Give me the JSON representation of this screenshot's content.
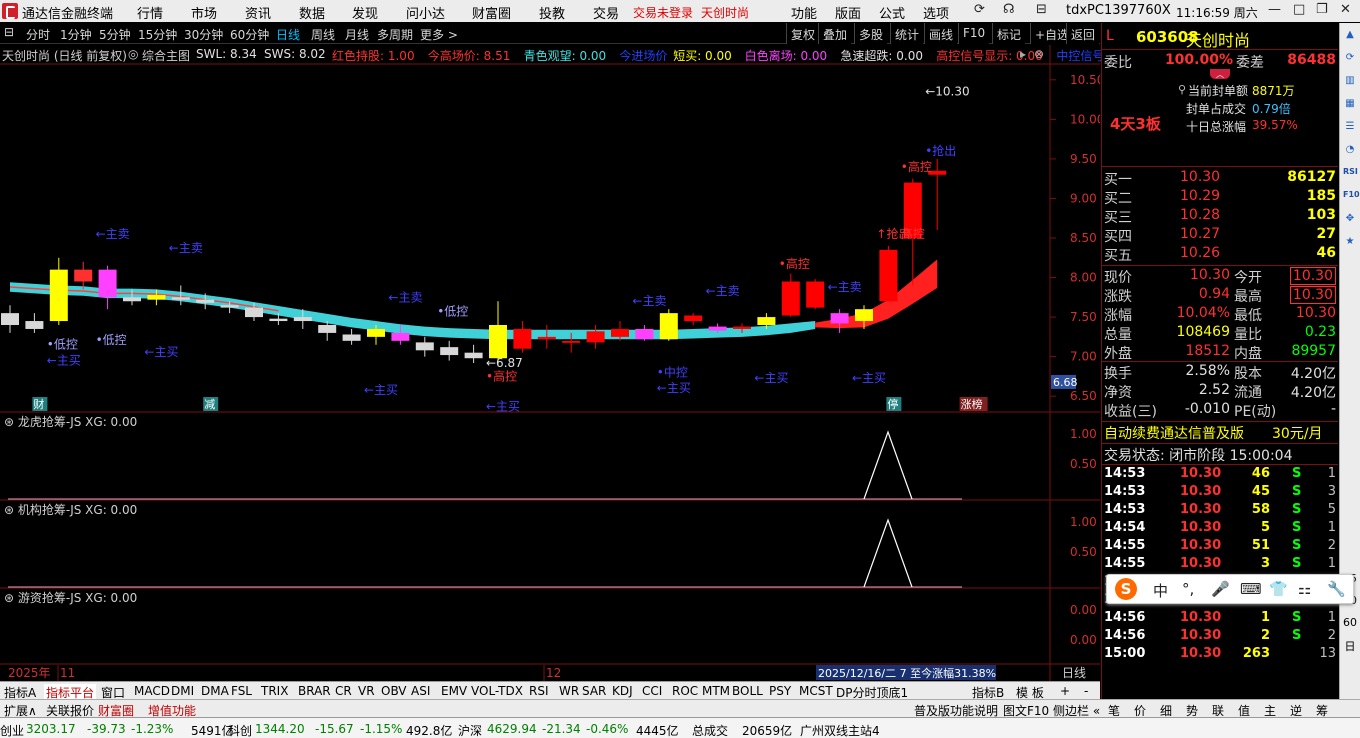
{
  "window": {
    "title": "通达信金融终端",
    "tdx": "tdxPC1397760X",
    "time": "11:16:59 周六"
  },
  "menu": [
    "行情",
    "市场",
    "资讯",
    "数据",
    "发现",
    "问小达",
    "财富圈",
    "投教",
    "交易"
  ],
  "menu_red": [
    "交易未登录",
    "天创时尚"
  ],
  "menu_right": [
    "功能",
    "版面",
    "公式",
    "选项"
  ],
  "toolbar": [
    "分时",
    "1分钟",
    "5分钟",
    "15分钟",
    "30分钟",
    "60分钟",
    "日线",
    "周线",
    "月线",
    "多周期",
    "更多 >"
  ],
  "toolbar_selected": "日线",
  "toolbar_right": [
    "复权",
    "叠加",
    "多股",
    "统计",
    "画线",
    "F10",
    "标记",
    "+自选",
    "返回"
  ],
  "indicator": {
    "name": "天创时尚 (日线 前复权)",
    "formula": "综合主图",
    "items": [
      {
        "t": "SWL: 8.34",
        "c": "#e0e0e0"
      },
      {
        "t": "SWS: 8.02",
        "c": "#e0e0e0"
      },
      {
        "t": "红色持股: 1.00",
        "c": "#ff3030"
      },
      {
        "t": "今高场价: 8.51",
        "c": "#ff3030"
      },
      {
        "t": "青色观望: 0.00",
        "c": "#40e0e0"
      },
      {
        "t": "今进场价",
        "c": "#2040ff"
      },
      {
        "t": "短买: 0.00",
        "c": "#ffff00"
      },
      {
        "t": "白色离场: 0.00",
        "c": "#ff40ff"
      },
      {
        "t": "急速超跌: 0.00",
        "c": "#e0e0e0"
      },
      {
        "t": "高控信号显示: 0.00",
        "c": "#ff3030"
      },
      {
        "t": "中控信号",
        "c": "#2040ff"
      }
    ]
  },
  "chart_data": {
    "type": "candlestick",
    "y_ticks": [
      "10.50",
      "10.00",
      "9.50",
      "9.00",
      "8.50",
      "8.00",
      "7.50",
      "7.00",
      "6.50"
    ],
    "ylim": [
      6.3,
      10.7
    ],
    "current_price_tag": "6.68",
    "x_labels": [
      "2025年",
      "11",
      "12"
    ],
    "candles": [
      {
        "o": 7.55,
        "c": 7.4,
        "h": 7.65,
        "l": 7.3,
        "col": "#d8d8d8"
      },
      {
        "o": 7.45,
        "c": 7.35,
        "h": 7.55,
        "l": 7.3,
        "col": "#d8d8d8"
      },
      {
        "o": 7.45,
        "c": 8.1,
        "h": 8.25,
        "l": 7.4,
        "col": "#ffff00"
      },
      {
        "o": 7.95,
        "c": 8.1,
        "h": 8.2,
        "l": 7.85,
        "col": "#ff3030"
      },
      {
        "o": 8.1,
        "c": 7.75,
        "h": 8.15,
        "l": 7.6,
        "col": "#ff40ff"
      },
      {
        "o": 7.75,
        "c": 7.7,
        "h": 7.85,
        "l": 7.65,
        "col": "#d8d8d8"
      },
      {
        "o": 7.72,
        "c": 7.78,
        "h": 7.85,
        "l": 7.65,
        "col": "#ffff00"
      },
      {
        "o": 7.75,
        "c": 7.72,
        "h": 7.9,
        "l": 7.65,
        "col": "#d8d8d8"
      },
      {
        "o": 7.72,
        "c": 7.68,
        "h": 7.8,
        "l": 7.6,
        "col": "#d8d8d8"
      },
      {
        "o": 7.65,
        "c": 7.62,
        "h": 7.7,
        "l": 7.55,
        "col": "#d8d8d8"
      },
      {
        "o": 7.62,
        "c": 7.5,
        "h": 7.68,
        "l": 7.45,
        "col": "#d8d8d8"
      },
      {
        "o": 7.48,
        "c": 7.45,
        "h": 7.55,
        "l": 7.4,
        "col": "#d8d8d8"
      },
      {
        "o": 7.45,
        "c": 7.5,
        "h": 7.6,
        "l": 7.35,
        "col": "#d8d8d8"
      },
      {
        "o": 7.4,
        "c": 7.3,
        "h": 7.45,
        "l": 7.2,
        "col": "#d8d8d8"
      },
      {
        "o": 7.28,
        "c": 7.2,
        "h": 7.35,
        "l": 7.15,
        "col": "#d8d8d8"
      },
      {
        "o": 7.25,
        "c": 7.35,
        "h": 7.4,
        "l": 7.15,
        "col": "#ffff00"
      },
      {
        "o": 7.3,
        "c": 7.2,
        "h": 7.4,
        "l": 7.15,
        "col": "#ff40ff"
      },
      {
        "o": 7.18,
        "c": 7.08,
        "h": 7.25,
        "l": 7.0,
        "col": "#d8d8d8"
      },
      {
        "o": 7.12,
        "c": 7.02,
        "h": 7.2,
        "l": 6.95,
        "col": "#d8d8d8"
      },
      {
        "o": 7.05,
        "c": 6.98,
        "h": 7.15,
        "l": 6.92,
        "col": "#d8d8d8"
      },
      {
        "o": 6.98,
        "c": 7.4,
        "h": 7.7,
        "l": 6.88,
        "col": "#ffff00"
      },
      {
        "o": 7.1,
        "c": 7.35,
        "h": 7.45,
        "l": 7.05,
        "col": "#ff0000"
      },
      {
        "o": 7.22,
        "c": 7.25,
        "h": 7.4,
        "l": 7.1,
        "col": "#ff0000"
      },
      {
        "o": 7.2,
        "c": 7.18,
        "h": 7.3,
        "l": 7.05,
        "col": "#ff0000"
      },
      {
        "o": 7.18,
        "c": 7.32,
        "h": 7.4,
        "l": 7.1,
        "col": "#ff0000"
      },
      {
        "o": 7.25,
        "c": 7.35,
        "h": 7.45,
        "l": 7.2,
        "col": "#ff0000"
      },
      {
        "o": 7.35,
        "c": 7.22,
        "h": 7.4,
        "l": 7.2,
        "col": "#ff40ff"
      },
      {
        "o": 7.22,
        "c": 7.55,
        "h": 7.6,
        "l": 7.2,
        "col": "#ffff00"
      },
      {
        "o": 7.45,
        "c": 7.52,
        "h": 7.55,
        "l": 7.4,
        "col": "#ff0000"
      },
      {
        "o": 7.38,
        "c": 7.33,
        "h": 7.42,
        "l": 7.3,
        "col": "#ff40ff"
      },
      {
        "o": 7.35,
        "c": 7.38,
        "h": 7.42,
        "l": 7.3,
        "col": "#ff0000"
      },
      {
        "o": 7.4,
        "c": 7.5,
        "h": 7.55,
        "l": 7.35,
        "col": "#ffff00"
      },
      {
        "o": 7.52,
        "c": 7.95,
        "h": 8.05,
        "l": 7.5,
        "col": "#ff0000"
      },
      {
        "o": 7.62,
        "c": 7.95,
        "h": 7.98,
        "l": 7.6,
        "col": "#ff0000"
      },
      {
        "o": 7.55,
        "c": 7.42,
        "h": 7.6,
        "l": 7.3,
        "col": "#ff40ff"
      },
      {
        "o": 7.45,
        "c": 7.6,
        "h": 7.65,
        "l": 7.35,
        "col": "#ffff00"
      },
      {
        "o": 7.7,
        "c": 8.35,
        "h": 8.4,
        "l": 7.7,
        "col": "#ff0000"
      },
      {
        "o": 8.5,
        "c": 9.2,
        "h": 9.25,
        "l": 7.9,
        "col": "#ff0000"
      },
      {
        "o": 9.3,
        "c": 9.35,
        "h": 9.5,
        "l": 8.6,
        "col": "#ff0000"
      }
    ],
    "annotations": [
      {
        "t": "←主卖",
        "i": 4,
        "v": 8.5,
        "c": "#4040ff"
      },
      {
        "t": "←主卖",
        "i": 7,
        "v": 8.32,
        "c": "#4040ff"
      },
      {
        "t": "←主卖",
        "i": 16,
        "v": 7.7,
        "c": "#4040ff"
      },
      {
        "t": "←主卖",
        "i": 26,
        "v": 7.65,
        "c": "#4040ff"
      },
      {
        "t": "←主卖",
        "i": 29,
        "v": 7.78,
        "c": "#4040ff"
      },
      {
        "t": "←主卖",
        "i": 34,
        "v": 7.83,
        "c": "#4040ff"
      },
      {
        "t": "•低控",
        "i": 2,
        "v": 7.1,
        "c": "#a0a0ff"
      },
      {
        "t": "•低控",
        "i": 4,
        "v": 7.16,
        "c": "#a0a0ff"
      },
      {
        "t": "•低控",
        "i": 18,
        "v": 7.52,
        "c": "#a0a0ff"
      },
      {
        "t": "←主买",
        "i": 2,
        "v": 6.9,
        "c": "#4040ff"
      },
      {
        "t": "←主买",
        "i": 6,
        "v": 7.01,
        "c": "#4040ff"
      },
      {
        "t": "←主买",
        "i": 15,
        "v": 6.53,
        "c": "#4040ff"
      },
      {
        "t": "←主买",
        "i": 20,
        "v": 6.32,
        "c": "#4040ff"
      },
      {
        "t": "←主买",
        "i": 27,
        "v": 6.55,
        "c": "#4040ff"
      },
      {
        "t": "←主买",
        "i": 31,
        "v": 6.68,
        "c": "#4040ff"
      },
      {
        "t": "←主买",
        "i": 35,
        "v": 6.68,
        "c": "#4040ff"
      },
      {
        "t": "•中控",
        "i": 27,
        "v": 6.75,
        "c": "#4040ff"
      },
      {
        "t": "←6.87",
        "i": 20,
        "v": 6.87,
        "c": "#e0e0e0"
      },
      {
        "t": "•高控",
        "i": 20,
        "v": 6.7,
        "c": "#ff3030"
      },
      {
        "t": "•高控",
        "i": 32,
        "v": 8.12,
        "c": "#ff3030"
      },
      {
        "t": "↑抢出",
        "i": 36,
        "v": 8.5,
        "c": "#ff3030"
      },
      {
        "t": "高控",
        "i": 37,
        "v": 8.5,
        "c": "#ff3030"
      },
      {
        "t": "•高控",
        "i": 37,
        "v": 9.35,
        "c": "#ff3030"
      },
      {
        "t": "•抢出",
        "i": 38,
        "v": 9.55,
        "c": "#4040ff"
      },
      {
        "t": "←10.30",
        "i": 38,
        "v": 10.3,
        "c": "#e0e0e0"
      }
    ],
    "bottom_marks": [
      {
        "t": "财",
        "i": 1,
        "bg": "#208080"
      },
      {
        "t": "减",
        "i": 8,
        "bg": "#208080"
      },
      {
        "t": "停",
        "i": 36,
        "bg": "#208080"
      },
      {
        "t": "涨榜",
        "i": 39,
        "bg": "#802020"
      }
    ],
    "sub_panes": [
      {
        "title": "龙虎抢筹-JS XG: 0.00",
        "ticks": [
          "1.00",
          "0.50"
        ],
        "spike": true
      },
      {
        "title": "机构抢筹-JS XG: 0.00",
        "ticks": [
          "1.00",
          "0.50"
        ],
        "spike": true
      },
      {
        "title": "游资抢筹-JS XG: 0.00",
        "ticks": [
          "0.00",
          "0.00"
        ],
        "spike": false
      }
    ],
    "date_tip": "2025/12/16/二 7 至今涨幅31.38%",
    "period_label": "日线"
  },
  "quote": {
    "flag": "L",
    "code": "603608",
    "name": "天创时尚",
    "weibi_label": "委比",
    "weibi": "100.00%",
    "weicha_label": "委差",
    "weicha": "86488",
    "board": "4天3板",
    "seal_amount_label": "当前封单额",
    "seal_amount": "8871万",
    "seal_ratio_label": "封单占成交",
    "seal_ratio": "0.79倍",
    "ten_day_label": "十日总涨幅",
    "ten_day": "39.57%",
    "bids": [
      {
        "l": "买一",
        "p": "10.30",
        "v": "86127"
      },
      {
        "l": "买二",
        "p": "10.29",
        "v": "185"
      },
      {
        "l": "买三",
        "p": "10.28",
        "v": "103"
      },
      {
        "l": "买四",
        "p": "10.27",
        "v": "27"
      },
      {
        "l": "买五",
        "p": "10.26",
        "v": "46"
      }
    ],
    "stats": [
      {
        "l1": "现价",
        "v1": "10.30",
        "l2": "今开",
        "v2": "10.30",
        "box": true
      },
      {
        "l1": "涨跌",
        "v1": "0.94",
        "l2": "最高",
        "v2": "10.30",
        "box": true
      },
      {
        "l1": "涨幅",
        "v1": "10.04%",
        "l2": "最低",
        "v2": "10.30"
      },
      {
        "l1": "总量",
        "v1": "108469",
        "l2": "量比",
        "v2": "0.23",
        "v1c": "#ffff00",
        "v2c": "#00ff00"
      },
      {
        "l1": "外盘",
        "v1": "18512",
        "l2": "内盘",
        "v2": "89957",
        "v1c": "#ff3030",
        "v2c": "#00ff00"
      }
    ],
    "stats2": [
      {
        "l1": "换手",
        "v1": "2.58%",
        "l2": "股本",
        "v2": "4.20亿"
      },
      {
        "l1": "净资",
        "v1": "2.52",
        "l2": "流通",
        "v2": "4.20亿"
      },
      {
        "l1": "收益(三)",
        "v1": "-0.010",
        "l2": "PE(动)",
        "v2": "-"
      }
    ],
    "ad": "自动续费通达信普及版",
    "ad_price": "30元/月",
    "trade_status": "交易状态: 闭市阶段 15:00:04",
    "ticks": [
      {
        "t": "14:53",
        "p": "10.30",
        "v": "46",
        "s": "S",
        "n": "1"
      },
      {
        "t": "14:53",
        "p": "10.30",
        "v": "45",
        "s": "S",
        "n": "3"
      },
      {
        "t": "14:53",
        "p": "10.30",
        "v": "58",
        "s": "S",
        "n": "5"
      },
      {
        "t": "14:54",
        "p": "10.30",
        "v": "5",
        "s": "S",
        "n": "1"
      },
      {
        "t": "14:55",
        "p": "10.30",
        "v": "51",
        "s": "S",
        "n": "2"
      },
      {
        "t": "14:55",
        "p": "10.30",
        "v": "3",
        "s": "S",
        "n": "1"
      },
      {
        "t": "14:56",
        "p": "10.30",
        "v": "5",
        "s": "S",
        "n": "1"
      },
      {
        "t": "14:56",
        "p": "10.30",
        "v": "5",
        "s": "S",
        "n": "1"
      },
      {
        "t": "14:56",
        "p": "10.30",
        "v": "1",
        "s": "S",
        "n": "1"
      },
      {
        "t": "14:56",
        "p": "10.30",
        "v": "2",
        "s": "S",
        "n": "2"
      },
      {
        "t": "15:00",
        "p": "10.30",
        "v": "263",
        "s": "",
        "n": "13"
      }
    ]
  },
  "tabs": [
    "指标A",
    "指标平台",
    "窗口",
    "MACD",
    "DMI",
    "DMA",
    "FSL",
    "TRIX",
    "BRAR",
    "CR",
    "VR",
    "OBV",
    "ASI",
    "EMV",
    "VOL-TDX",
    "RSI",
    "WR",
    "SAR",
    "KDJ",
    "CCI",
    "ROC",
    "MTM",
    "BOLL",
    "PSY",
    "MCST",
    "DP分时顶底1"
  ],
  "tabs_right": [
    "指标B",
    "模 板",
    "+",
    "-"
  ],
  "tabs2_left": [
    "扩展∧",
    "关联报价",
    "财富圈",
    "增值功能"
  ],
  "tabs2_mid": [
    "普及版功能说明",
    "图文F10",
    "侧边栏 «"
  ],
  "tabs2_right": [
    "笔",
    "价",
    "细",
    "势",
    "联",
    "值",
    "主",
    "逆",
    "筹"
  ],
  "status": [
    {
      "t": "创业",
      "c": "#000"
    },
    {
      "t": "3203.17",
      "c": "#008000"
    },
    {
      "t": "-39.73",
      "c": "#008000"
    },
    {
      "t": "-1.23%",
      "c": "#008000"
    },
    {
      "t": "5491亿",
      "c": "#000"
    },
    {
      "t": "科创",
      "c": "#000"
    },
    {
      "t": "1344.20",
      "c": "#008000"
    },
    {
      "t": "-15.67",
      "c": "#008000"
    },
    {
      "t": "-1.15%",
      "c": "#008000"
    },
    {
      "t": "492.8亿",
      "c": "#000"
    },
    {
      "t": "沪深",
      "c": "#000"
    },
    {
      "t": "4629.94",
      "c": "#008000"
    },
    {
      "t": "-21.34",
      "c": "#008000"
    },
    {
      "t": "-0.46%",
      "c": "#008000"
    },
    {
      "t": "4445亿",
      "c": "#000"
    },
    {
      "t": "总成交",
      "c": "#000"
    },
    {
      "t": "20659亿",
      "c": "#000"
    },
    {
      "t": "广州双线主站4",
      "c": "#000"
    }
  ],
  "strip_icons": [
    "arrow-up-icon",
    "refresh-icon",
    "bar-icon",
    "grid-icon",
    "list-icon",
    "chart-icon",
    "rsi-icon",
    "f10-icon",
    "move-icon",
    "star-icon"
  ],
  "strip_labels": [
    "日",
    "60",
    "30",
    "15"
  ],
  "ime": {
    "logo": "S",
    "items": [
      "中",
      "°,",
      "🎤",
      "⌨",
      "👕",
      "⚏",
      "🔧"
    ]
  }
}
